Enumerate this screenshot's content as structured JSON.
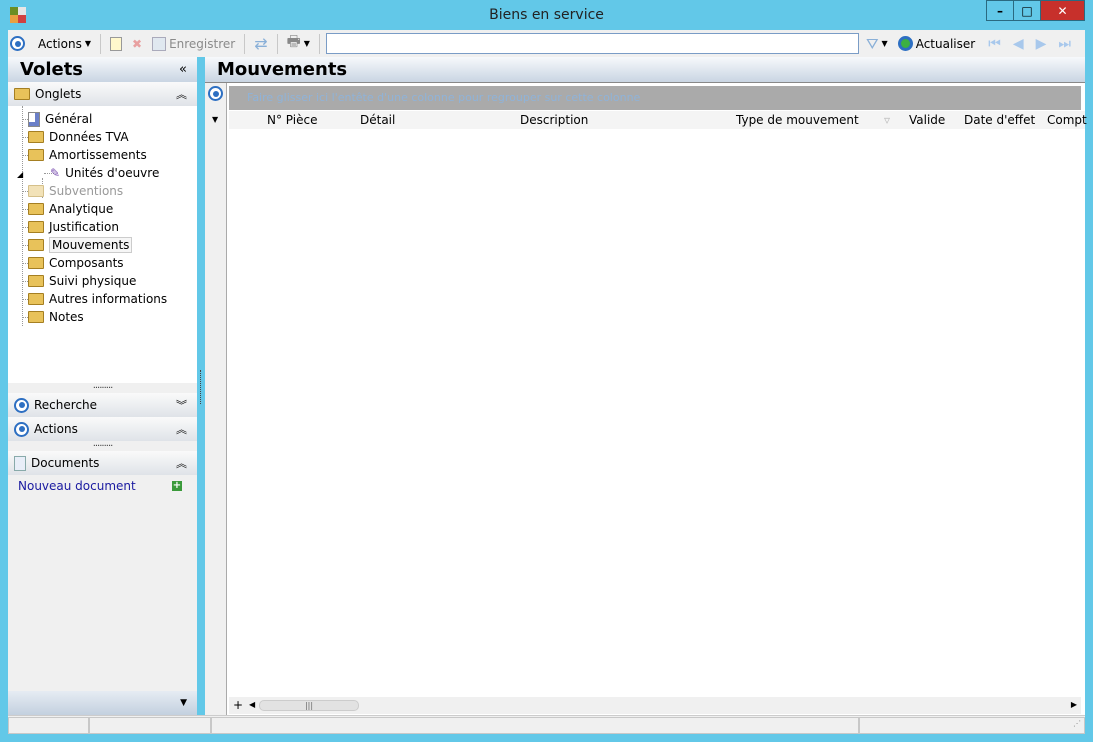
{
  "window": {
    "title": "Biens en service",
    "minimize": "–",
    "maximize": "□",
    "close": "✕"
  },
  "toolbar": {
    "actions": "Actions",
    "save": "Enregistrer",
    "search_value": "",
    "refresh": "Actualiser"
  },
  "left": {
    "title": "Volets",
    "collapse": "«",
    "onglets": {
      "title": "Onglets",
      "items": [
        {
          "label": "Général",
          "icon": "gear-doc-icon",
          "level": 1
        },
        {
          "label": "Données TVA",
          "icon": "folder-icon",
          "level": 1
        },
        {
          "label": "Amortissements",
          "icon": "folder-icon",
          "level": 1
        },
        {
          "label": "Unités d'oeuvre",
          "icon": "tool-icon",
          "level": 2
        },
        {
          "label": "Subventions",
          "icon": "folder-icon",
          "level": 1,
          "disabled": true
        },
        {
          "label": "Analytique",
          "icon": "folder-icon",
          "level": 1
        },
        {
          "label": "Justification",
          "icon": "folder-icon",
          "level": 1
        },
        {
          "label": "Mouvements",
          "icon": "folder-open-icon",
          "level": 1,
          "selected": true
        },
        {
          "label": "Composants",
          "icon": "folder-icon",
          "level": 1
        },
        {
          "label": "Suivi physique",
          "icon": "folder-icon",
          "level": 1
        },
        {
          "label": "Autres informations",
          "icon": "folder-icon",
          "level": 1
        },
        {
          "label": "Notes",
          "icon": "folder-icon",
          "level": 1
        }
      ]
    },
    "recherche": "Recherche",
    "actions": "Actions",
    "documents": "Documents",
    "new_document": "Nouveau document"
  },
  "main": {
    "title": "Mouvements",
    "group_hint": "Faire glisser ici l'entête d'une colonne pour regrouper sur cette colonne",
    "columns": [
      "N° Pièce",
      "Détail",
      "Description",
      "Type de mouvement",
      "Valide",
      "Date d'effet",
      "Compt"
    ]
  }
}
